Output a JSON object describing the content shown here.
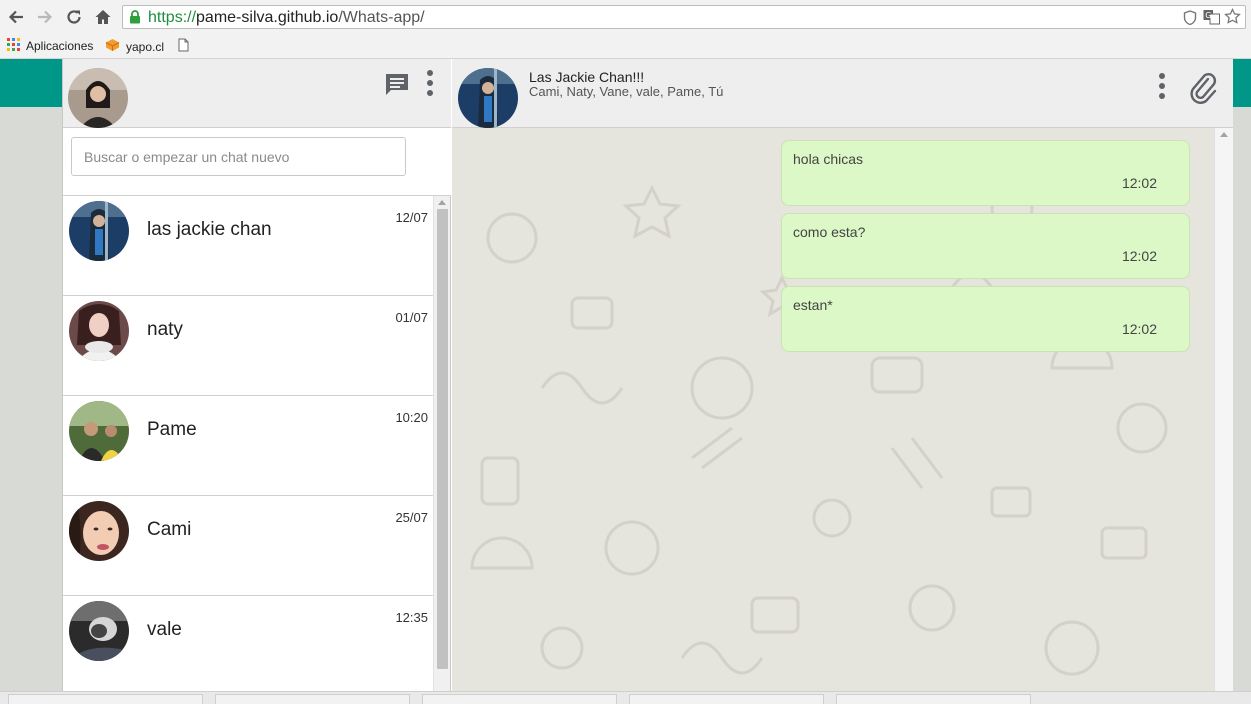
{
  "browser": {
    "url_scheme": "https://",
    "url_host": "pame-silva.github.io",
    "url_path": "/Whats-app/",
    "bookmarks": [
      {
        "label": "Aplicaciones",
        "icon": "apps-grid-icon"
      },
      {
        "label": "yapo.cl",
        "icon": "yapo-logo-icon"
      },
      {
        "label": "",
        "icon": "page-icon"
      }
    ]
  },
  "sidebar": {
    "search_placeholder": "Buscar o empezar un chat nuevo",
    "chats": [
      {
        "name": "las jackie chan",
        "time": "12/07"
      },
      {
        "name": "naty",
        "time": "01/07"
      },
      {
        "name": "Pame",
        "time": "10:20"
      },
      {
        "name": "Cami",
        "time": "25/07"
      },
      {
        "name": "vale",
        "time": "12:35"
      }
    ]
  },
  "conversation": {
    "title": "Las Jackie Chan!!!",
    "members": "Cami, Naty, Vane, vale, Pame, Tú",
    "messages": [
      {
        "text": "hola chicas",
        "time": "12:02"
      },
      {
        "text": "como esta?",
        "time": "12:02"
      },
      {
        "text": "estan*",
        "time": "12:02"
      }
    ]
  },
  "colors": {
    "accent_green": "#009688",
    "outgoing_bubble": "#dcf8c6",
    "header_gray": "#eeeeee",
    "chat_background": "#e5e4dd"
  }
}
